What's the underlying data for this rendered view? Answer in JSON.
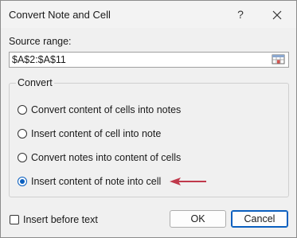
{
  "window": {
    "title": "Convert Note and Cell",
    "help_label": "?",
    "close_icon": "close-icon"
  },
  "source": {
    "label": "Source range:",
    "value": "$A$2:$A$11",
    "picker_icon": "range-select-icon"
  },
  "convert": {
    "legend": "Convert",
    "options": [
      {
        "label": "Convert content of cells into notes",
        "checked": false
      },
      {
        "label": "Insert content of cell into note",
        "checked": false
      },
      {
        "label": "Convert notes into content of cells",
        "checked": false
      },
      {
        "label": "Insert content of note into cell",
        "checked": true
      }
    ]
  },
  "footer": {
    "insert_before_label": "Insert before text",
    "insert_before_checked": false,
    "ok_label": "OK",
    "cancel_label": "Cancel"
  },
  "colors": {
    "accent": "#0a5fbf",
    "arrow": "#c0394b",
    "background": "#f0f0f0"
  }
}
